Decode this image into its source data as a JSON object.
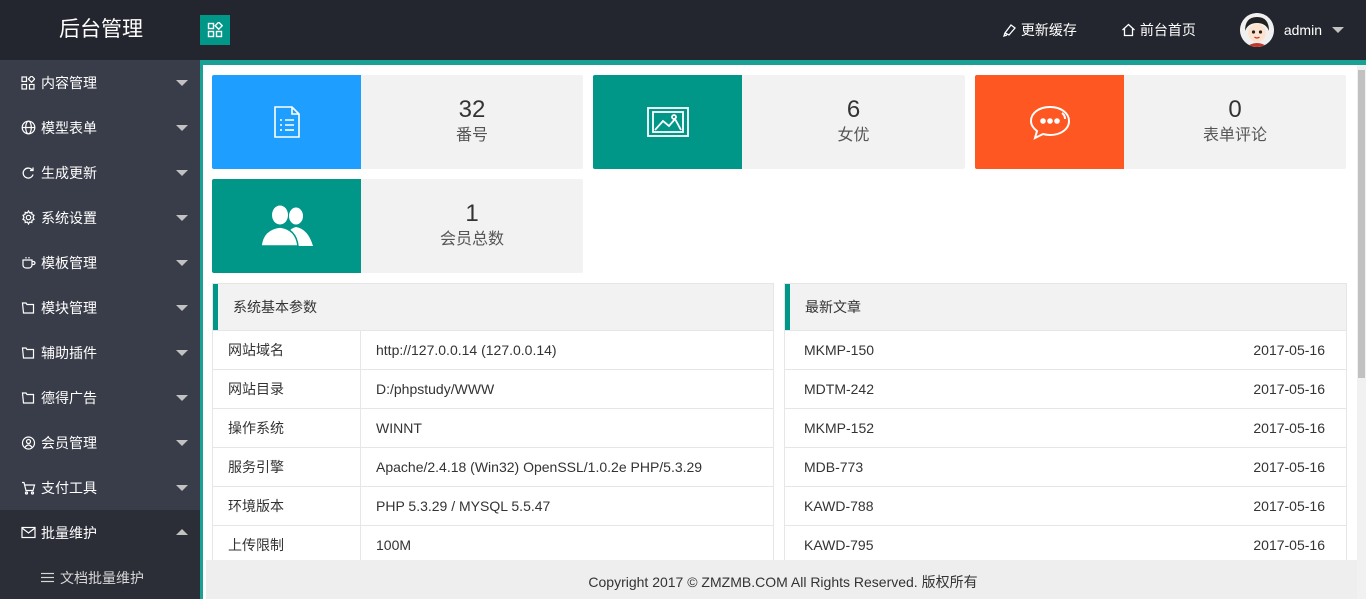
{
  "header": {
    "title": "后台管理",
    "links": [
      {
        "label": "更新缓存",
        "icon": "brush-icon"
      },
      {
        "label": "前台首页",
        "icon": "home-icon"
      }
    ],
    "user": {
      "name": "admin"
    }
  },
  "sidebar": {
    "items": [
      {
        "label": "内容管理",
        "icon": "grid-icon"
      },
      {
        "label": "模型表单",
        "icon": "globe-icon"
      },
      {
        "label": "生成更新",
        "icon": "refresh-icon"
      },
      {
        "label": "系统设置",
        "icon": "gear-icon"
      },
      {
        "label": "模板管理",
        "icon": "cup-icon"
      },
      {
        "label": "模块管理",
        "icon": "folder-icon"
      },
      {
        "label": "辅助插件",
        "icon": "folder-icon"
      },
      {
        "label": "德得广告",
        "icon": "folder-icon"
      },
      {
        "label": "会员管理",
        "icon": "users-icon"
      },
      {
        "label": "支付工具",
        "icon": "cart-icon"
      },
      {
        "label": "批量维护",
        "icon": "mail-icon"
      }
    ],
    "sub_items": [
      {
        "label": "文档批量维护",
        "icon": "list-icon"
      }
    ]
  },
  "stats": [
    {
      "value": "32",
      "label": "番号",
      "color": "#1e9fff",
      "icon": "document-icon"
    },
    {
      "value": "6",
      "label": "女优",
      "color": "#009688",
      "icon": "image-icon"
    },
    {
      "value": "0",
      "label": "表单评论",
      "color": "#ff5722",
      "icon": "chat-bubble-icon"
    },
    {
      "value": "1",
      "label": "会员总数",
      "color": "#009688",
      "icon": "users-icon"
    }
  ],
  "system_info": {
    "title": "系统基本参数",
    "rows": [
      {
        "key": "网站域名",
        "value": "http://127.0.0.14 (127.0.0.14)"
      },
      {
        "key": "网站目录",
        "value": "D:/phpstudy/WWW"
      },
      {
        "key": "操作系统",
        "value": "WINNT"
      },
      {
        "key": "服务引擎",
        "value": "Apache/2.4.18 (Win32) OpenSSL/1.0.2e PHP/5.3.29"
      },
      {
        "key": "环境版本",
        "value": "PHP 5.3.29 / MYSQL 5.5.47"
      },
      {
        "key": "上传限制",
        "value": "100M"
      }
    ]
  },
  "latest_articles": {
    "title": "最新文章",
    "rows": [
      {
        "title": "MKMP-150",
        "date": "2017-05-16"
      },
      {
        "title": "MDTM-242",
        "date": "2017-05-16"
      },
      {
        "title": "MKMP-152",
        "date": "2017-05-16"
      },
      {
        "title": "MDB-773",
        "date": "2017-05-16"
      },
      {
        "title": "KAWD-788",
        "date": "2017-05-16"
      },
      {
        "title": "KAWD-795",
        "date": "2017-05-16"
      }
    ]
  },
  "footer": {
    "text": "Copyright 2017 © ZMZMB.COM All Rights Reserved. 版权所有"
  }
}
